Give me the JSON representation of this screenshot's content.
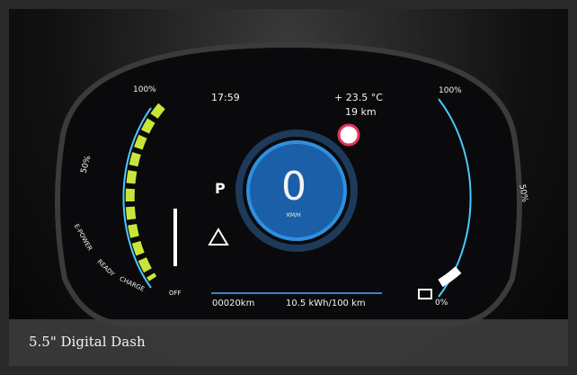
{
  "dash": {
    "time": "17:59",
    "outside_temp": "+ 23.5 °C",
    "range": "19 km",
    "gear": "P",
    "speed": "0",
    "speed_unit": "KM/H",
    "odometer": "00020km",
    "consumption": "10.5 kWh/100 km",
    "left_gauge": {
      "top_label": "100%",
      "mid_label": "50%",
      "labels": [
        "E-POWER",
        "READY",
        "CHARGE",
        "OFF"
      ],
      "level": 1.0
    },
    "right_gauge": {
      "top_label": "100%",
      "mid_label": "50%",
      "bottom_label": "0%",
      "charge_level": 0.12
    },
    "colors": {
      "accent_green": "#c8e63a",
      "accent_blue": "#4cc8ff",
      "speed_ring": "#2f8fe0"
    }
  },
  "caption": {
    "text": "5.5\" Digital Dash"
  }
}
